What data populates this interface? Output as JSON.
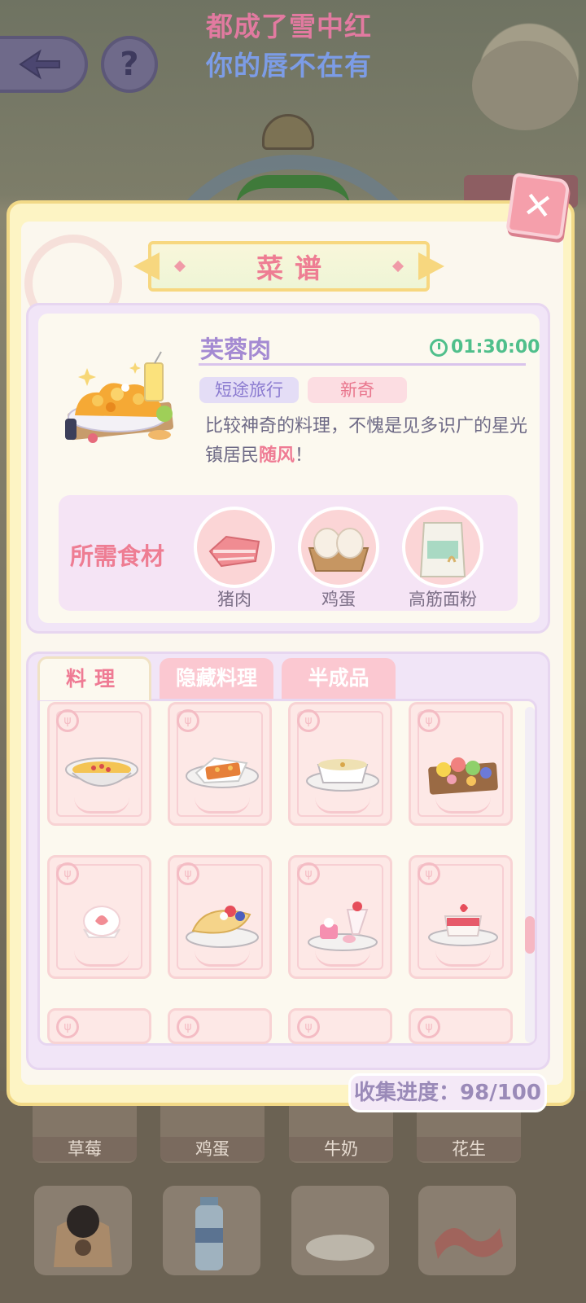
{
  "lyrics": {
    "line1": "都成了雪中红",
    "line2": "你的唇不在有"
  },
  "top_buttons": {
    "back_icon": "back-arrow-icon",
    "help_label": "?"
  },
  "panel": {
    "title": "菜谱",
    "close_label": "✕"
  },
  "recipe_detail": {
    "dish_name": "芙蓉肉",
    "timer": "01:30:00",
    "tags": [
      "短途旅行",
      "新奇"
    ],
    "description_before": "比较神奇的料理，不愧是见多识广的星光镇居民",
    "description_highlight": "随风",
    "description_after": "！",
    "ingredients_title": "所需食材",
    "ingredients": [
      {
        "label": "猪肉",
        "icon": "pork-icon"
      },
      {
        "label": "鸡蛋",
        "icon": "eggs-icon"
      },
      {
        "label": "高筋面粉",
        "icon": "flour-bag-icon"
      }
    ]
  },
  "tabs": [
    {
      "label": "料理",
      "active": true
    },
    {
      "label": "隐藏料理",
      "active": false
    },
    {
      "label": "半成品",
      "active": false
    }
  ],
  "recipe_grid": [
    {
      "icon": "soup-bowl-icon"
    },
    {
      "icon": "toast-plate-icon"
    },
    {
      "icon": "cream-soup-icon"
    },
    {
      "icon": "fruit-board-icon"
    },
    {
      "icon": "strawberry-daifuku-icon"
    },
    {
      "icon": "fruit-crepe-icon"
    },
    {
      "icon": "dessert-platter-icon"
    },
    {
      "icon": "strawberry-pudding-icon"
    }
  ],
  "progress": {
    "text": "收集进度：98/100",
    "collected": 98,
    "total": 100
  },
  "shelf_labels": [
    "草莓",
    "鸡蛋",
    "牛奶",
    "花生"
  ],
  "colors": {
    "accent_pink": "#ee7d93",
    "accent_purple": "#a48ad2",
    "timer_green": "#4fbf8b",
    "panel_gold": "#f2d987"
  }
}
